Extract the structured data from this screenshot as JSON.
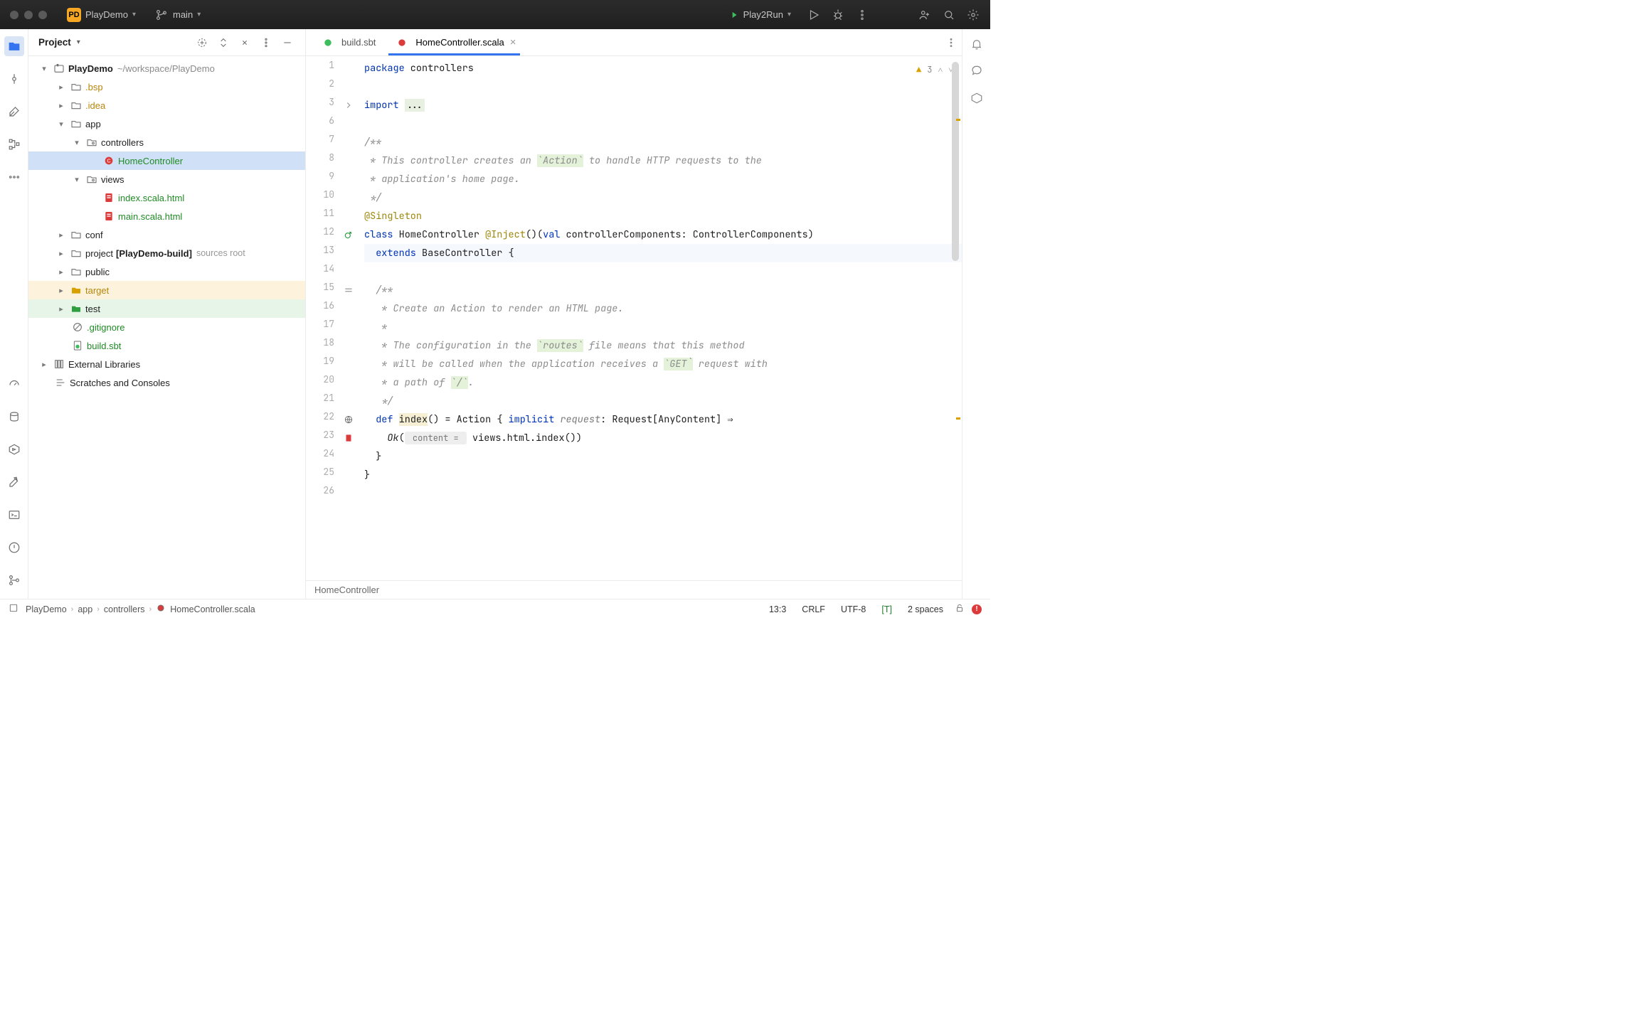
{
  "titlebar": {
    "project_badge": "PD",
    "project_name": "PlayDemo",
    "branch": "main",
    "run_config": "Play2Run"
  },
  "project_panel": {
    "title": "Project",
    "root": {
      "name": "PlayDemo",
      "path": "~/workspace/PlayDemo"
    },
    "folders": {
      "bsp": ".bsp",
      "idea": ".idea",
      "app": "app",
      "controllers": "controllers",
      "home_controller": "HomeController",
      "views": "views",
      "index_html": "index.scala.html",
      "main_html": "main.scala.html",
      "conf": "conf",
      "project": "project",
      "project_build": "[PlayDemo-build]",
      "project_src": "sources root",
      "public": "public",
      "target": "target",
      "test": "test",
      "gitignore": ".gitignore",
      "build_sbt": "build.sbt"
    },
    "ext_lib": "External Libraries",
    "scratches": "Scratches and Consoles"
  },
  "tabs": {
    "build": "build.sbt",
    "controller": "HomeController.scala"
  },
  "code": {
    "l1a": "package",
    "l1b": " controllers",
    "l3a": "import ",
    "l3b": "...",
    "l7": "/**",
    "l8a": " * This controller creates an ",
    "l8b": "`Action`",
    "l8c": " to handle HTTP requests to the",
    "l9": " * application's home page.",
    "l10": " */",
    "l11": "@Singleton",
    "l12a": "class",
    "l12b": " HomeController ",
    "l12c": "@Inject",
    "l12d": "()(",
    "l12e": "val",
    "l12f": " controllerComponents: ControllerComponents)",
    "l13a": "  ",
    "l13b": "extends",
    "l13c": " BaseController {",
    "l15": "  /**",
    "l16": "   * Create an Action to render an HTML page.",
    "l17": "   *",
    "l18a": "   * The configuration in the ",
    "l18b": "`routes`",
    "l18c": " file means that this method",
    "l19a": "   * will be called when the application receives a ",
    "l19b": "`GET`",
    "l19c": " request with",
    "l20a": "   * a path of ",
    "l20b": "`/`",
    "l20c": ".",
    "l21": "   */",
    "l22a": "  ",
    "l22b": "def",
    "l22c": " ",
    "l22d": "index",
    "l22e": "() = Action { ",
    "l22f": "implicit",
    "l22g": " ",
    "l22h": "request",
    "l22i": ": Request[AnyContent] ⇒",
    "l23a": "    ",
    "l23b": "Ok",
    "l23c": "(",
    "l23d": " content = ",
    "l23e": " views.html.index())",
    "l24": "  }",
    "l25": "}",
    "line_numbers": [
      "1",
      "2",
      "3",
      "6",
      "7",
      "8",
      "9",
      "10",
      "11",
      "12",
      "13",
      "14",
      "15",
      "16",
      "17",
      "18",
      "19",
      "20",
      "21",
      "22",
      "23",
      "24",
      "25",
      "26"
    ]
  },
  "inspections": {
    "warnings": "3"
  },
  "breadcrumb_class": "HomeController",
  "breadcrumbs": [
    "PlayDemo",
    "app",
    "controllers",
    "HomeController.scala"
  ],
  "status": {
    "pos": "13:3",
    "sep": "CRLF",
    "enc": "UTF-8",
    "tab": "[T]",
    "indent": "2 spaces"
  }
}
